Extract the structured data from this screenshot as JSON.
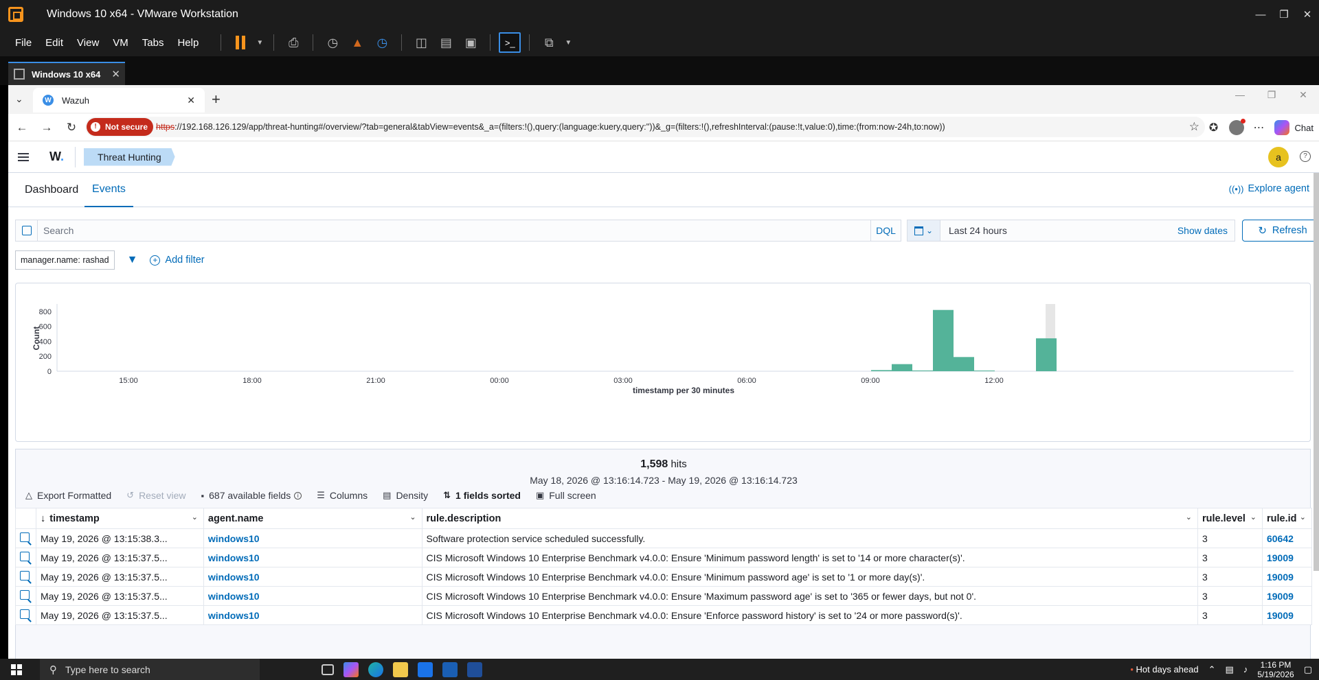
{
  "vmware": {
    "title": "Windows 10 x64 - VMware Workstation",
    "menu": [
      "File",
      "Edit",
      "View",
      "VM",
      "Tabs",
      "Help"
    ],
    "tab_label": "Windows 10 x64"
  },
  "browser": {
    "tab_title": "Wazuh",
    "not_secure": "Not secure",
    "url_scheme": "https",
    "url_rest": "://192.168.126.129/app/threat-hunting#/overview/?tab=general&tabView=events&_a=(filters:!(),query:(language:kuery,query:''))&_g=(filters:!(),refreshInterval:(pause:!t,value:0),time:(from:now-24h,to:now))",
    "chat_label": "Chat"
  },
  "wazuh": {
    "logo": "W",
    "breadcrumb": "Threat Hunting",
    "user_initial": "a",
    "tabs": {
      "dashboard": "Dashboard",
      "events": "Events"
    },
    "explore_agent": "Explore agent",
    "search_placeholder": "Search",
    "dql": "DQL",
    "date_range": "Last 24 hours",
    "show_dates": "Show dates",
    "refresh": "Refresh",
    "filter_pill": "manager.name: rashad",
    "add_filter": "Add filter"
  },
  "chart_data": {
    "type": "bar",
    "title": "",
    "xlabel": "timestamp per 30 minutes",
    "ylabel": "Count",
    "ylim": [
      0,
      900
    ],
    "yticks": [
      0,
      200,
      400,
      600,
      800
    ],
    "xticks": [
      "15:00",
      "18:00",
      "21:00",
      "00:00",
      "03:00",
      "06:00",
      "09:00",
      "12:00"
    ],
    "bars": [
      {
        "x": "09:00",
        "value": 15
      },
      {
        "x": "09:30",
        "value": 95
      },
      {
        "x": "10:00",
        "value": 10
      },
      {
        "x": "10:30",
        "value": 820
      },
      {
        "x": "11:00",
        "value": 190
      },
      {
        "x": "11:30",
        "value": 5
      },
      {
        "x": "13:00",
        "value": 440
      }
    ],
    "bar_color": "#54b399",
    "grid": false
  },
  "hits": {
    "count": "1,598",
    "label": "hits",
    "range": "May 18, 2026 @ 13:16:14.723 - May 19, 2026 @ 13:16:14.723"
  },
  "toolbar": {
    "export": "Export Formatted",
    "reset": "Reset view",
    "fields": "687 available fields",
    "columns": "Columns",
    "density": "Density",
    "sorted": "1 fields sorted",
    "fullscreen": "Full screen"
  },
  "table": {
    "headers": [
      "timestamp",
      "agent.name",
      "rule.description",
      "rule.level",
      "rule.id"
    ],
    "rows": [
      [
        "May 19, 2026 @ 13:15:38.3...",
        "windows10",
        "Software protection service scheduled successfully.",
        "3",
        "60642"
      ],
      [
        "May 19, 2026 @ 13:15:37.5...",
        "windows10",
        "CIS Microsoft Windows 10 Enterprise Benchmark v4.0.0: Ensure 'Minimum password length' is set to '14 or more character(s)'.",
        "3",
        "19009"
      ],
      [
        "May 19, 2026 @ 13:15:37.5...",
        "windows10",
        "CIS Microsoft Windows 10 Enterprise Benchmark v4.0.0: Ensure 'Minimum password age' is set to '1 or more day(s)'.",
        "3",
        "19009"
      ],
      [
        "May 19, 2026 @ 13:15:37.5...",
        "windows10",
        "CIS Microsoft Windows 10 Enterprise Benchmark v4.0.0: Ensure 'Maximum password age' is set to '365 or fewer days, but not 0'.",
        "3",
        "19009"
      ],
      [
        "May 19, 2026 @ 13:15:37.5...",
        "windows10",
        "CIS Microsoft Windows 10 Enterprise Benchmark v4.0.0: Ensure 'Enforce password history' is set to '24 or more password(s)'.",
        "3",
        "19009"
      ]
    ]
  },
  "taskbar": {
    "search_placeholder": "Type here to search",
    "weather": "Hot days ahead",
    "time": "1:16 PM",
    "date": "5/19/2026"
  }
}
